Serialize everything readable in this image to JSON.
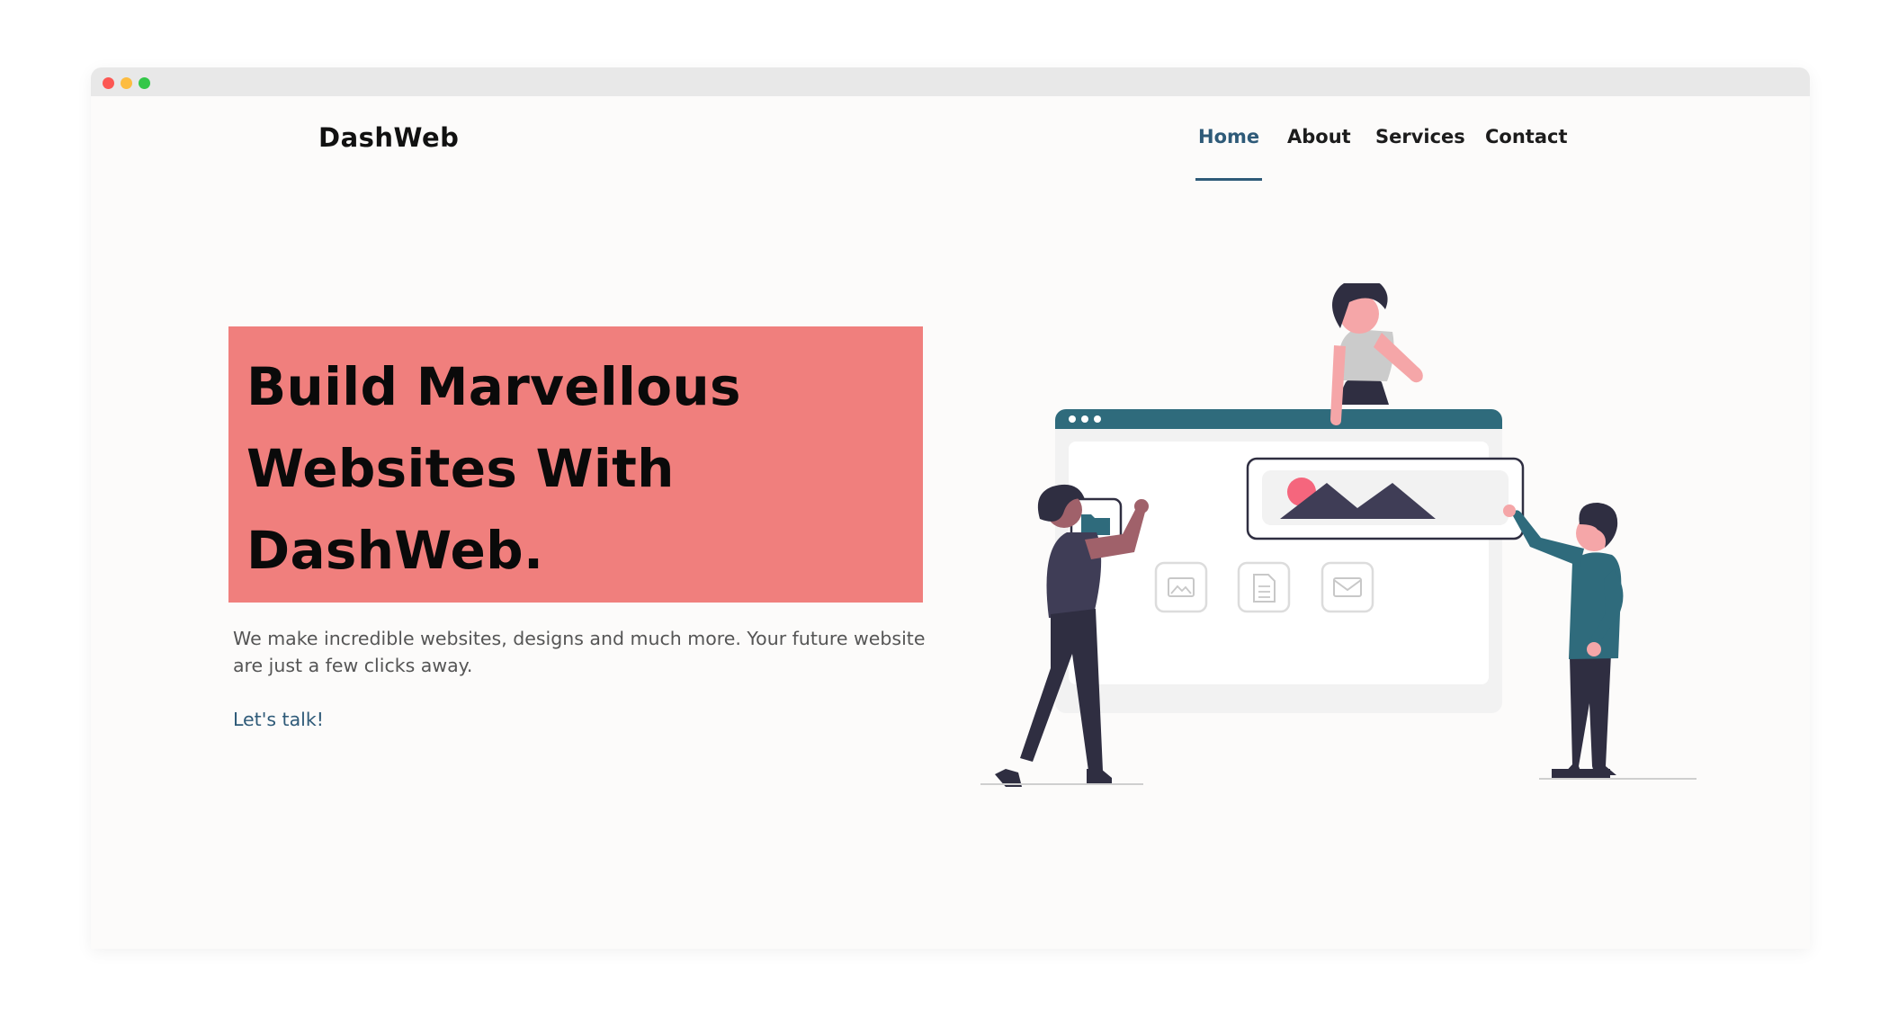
{
  "window": {
    "controls": [
      "close",
      "minimize",
      "maximize"
    ]
  },
  "brand": {
    "name": "DashWeb"
  },
  "nav": {
    "items": [
      {
        "label": "Home",
        "active": true
      },
      {
        "label": "About",
        "active": false
      },
      {
        "label": "Services",
        "active": false
      },
      {
        "label": "Contact",
        "active": false
      }
    ]
  },
  "hero": {
    "title_lines": [
      "Build Marvellous",
      "Websites With",
      "DashWeb."
    ],
    "description": "We make incredible websites, designs and much more. Your future website are just a few clicks away.",
    "cta_label": "Let's talk!"
  },
  "colors": {
    "accent": "#2e5a78",
    "hero_bg": "#f07f7d",
    "page_bg": "#fcfbfa",
    "illustration_teal": "#2f6b7c",
    "illustration_dark": "#2f2e41",
    "illustration_pink": "#f5a6a8"
  },
  "illustration": {
    "icons": [
      "folder-icon",
      "image-icon",
      "document-icon",
      "mail-icon",
      "mountain-image-icon"
    ]
  }
}
